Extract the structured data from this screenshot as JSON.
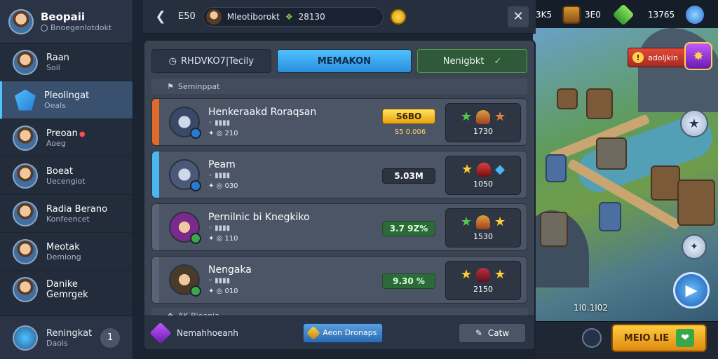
{
  "profile": {
    "name": "Beopaii",
    "subtitle": "Bnoegenlotdokt"
  },
  "sidebar": {
    "items": [
      {
        "label": "Raan",
        "sub": "Soil"
      },
      {
        "label": "Pleolingat",
        "sub": "Oeals"
      },
      {
        "label": "Preoan",
        "sub": "Aoeg"
      },
      {
        "label": "Boeat",
        "sub": "Uecengiot"
      },
      {
        "label": "Radia Berano",
        "sub": "Konfeencet"
      },
      {
        "label": "Meotak",
        "sub": "Demiong"
      },
      {
        "label": "Danike Gemrgek",
        "sub": ""
      }
    ],
    "bottom": {
      "label": "Reningkat",
      "sub": "Daois",
      "count": "1"
    }
  },
  "topbar": {
    "level": "E50",
    "player_name": "Mleotiborokt",
    "player_value": "28130"
  },
  "resources": [
    {
      "value": "3K5"
    },
    {
      "value": "3E0"
    },
    {
      "value": "13765"
    }
  ],
  "tabs": [
    "RHDVKO7|Tecily",
    "MEMAKON",
    "Nenigbkt"
  ],
  "section_title": "Seminppat",
  "rows": [
    {
      "title": "Henkeraakd Roraqsan",
      "stats": "✦ ◎ 210",
      "pill": "S6BO",
      "pill_sub": "S5 0.006",
      "reward": "1730"
    },
    {
      "title": "Peam",
      "stats": "✦ ◎ 030",
      "pill": "5.03M",
      "reward": "1050"
    },
    {
      "title": "Pernilnic bi Knegkiko",
      "stats": "✦ ◎ 110",
      "pill": "3.7 9Z%",
      "reward": "1530"
    },
    {
      "title": "Nengaka",
      "stats": "✦ ◎ 010",
      "pill": "9.30 %",
      "reward": "2150"
    }
  ],
  "section2_title": "AK Bioenia",
  "bottom": {
    "left_label": "Nemahhoeanh",
    "primary_btn": "Aeon Dronaps",
    "cat_btn": "Catw"
  },
  "map": {
    "alert_label": "adoljkin",
    "coords": "1I0.1I02",
    "start_btn": "MEIO LIE"
  },
  "colors": {
    "accent": "#4cc2ff",
    "gold": "#ffcc40",
    "green": "#3aa84a"
  }
}
